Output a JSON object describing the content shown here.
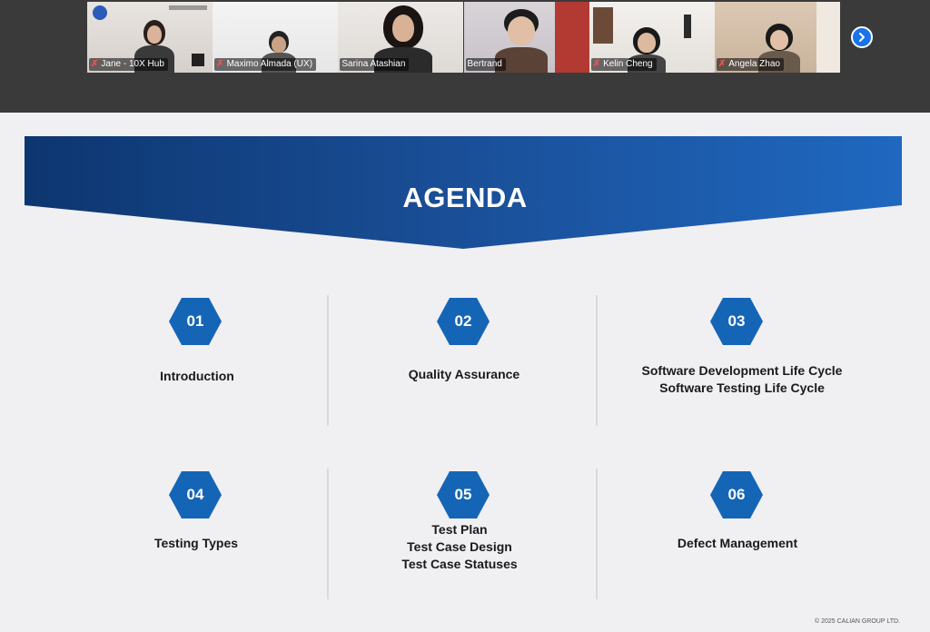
{
  "meeting": {
    "participants": [
      {
        "name": "Jane - 10X Hub",
        "muted": true,
        "active": false
      },
      {
        "name": "Maximo Almada (UX)",
        "muted": true,
        "active": false
      },
      {
        "name": "Sarina Atashian",
        "muted": false,
        "active": true
      },
      {
        "name": "Bertrand",
        "muted": false,
        "active": false
      },
      {
        "name": "Kelin Cheng",
        "muted": true,
        "active": false
      },
      {
        "name": "Angela Zhao",
        "muted": true,
        "active": false
      }
    ],
    "mic_off_glyph": "✗",
    "next_icon": "chevron-right-icon",
    "active_color": "#3fd67a"
  },
  "slide": {
    "title": "AGENDA",
    "banner_color_dark": "#0d3670",
    "banner_color_light": "#1e63b8",
    "hex_color": "#1565b7",
    "items": [
      {
        "number": "01",
        "lines": [
          "Introduction"
        ]
      },
      {
        "number": "02",
        "lines": [
          "Quality Assurance"
        ]
      },
      {
        "number": "03",
        "lines": [
          "Software Development Life Cycle",
          "Software Testing Life Cycle"
        ]
      },
      {
        "number": "04",
        "lines": [
          "Testing Types"
        ]
      },
      {
        "number": "05",
        "lines": [
          "Test Plan",
          "Test Case Design",
          "Test Case Statuses"
        ]
      },
      {
        "number": "06",
        "lines": [
          "Defect Management"
        ]
      }
    ],
    "copyright": "© 2025 CALIAN GROUP LTD."
  }
}
